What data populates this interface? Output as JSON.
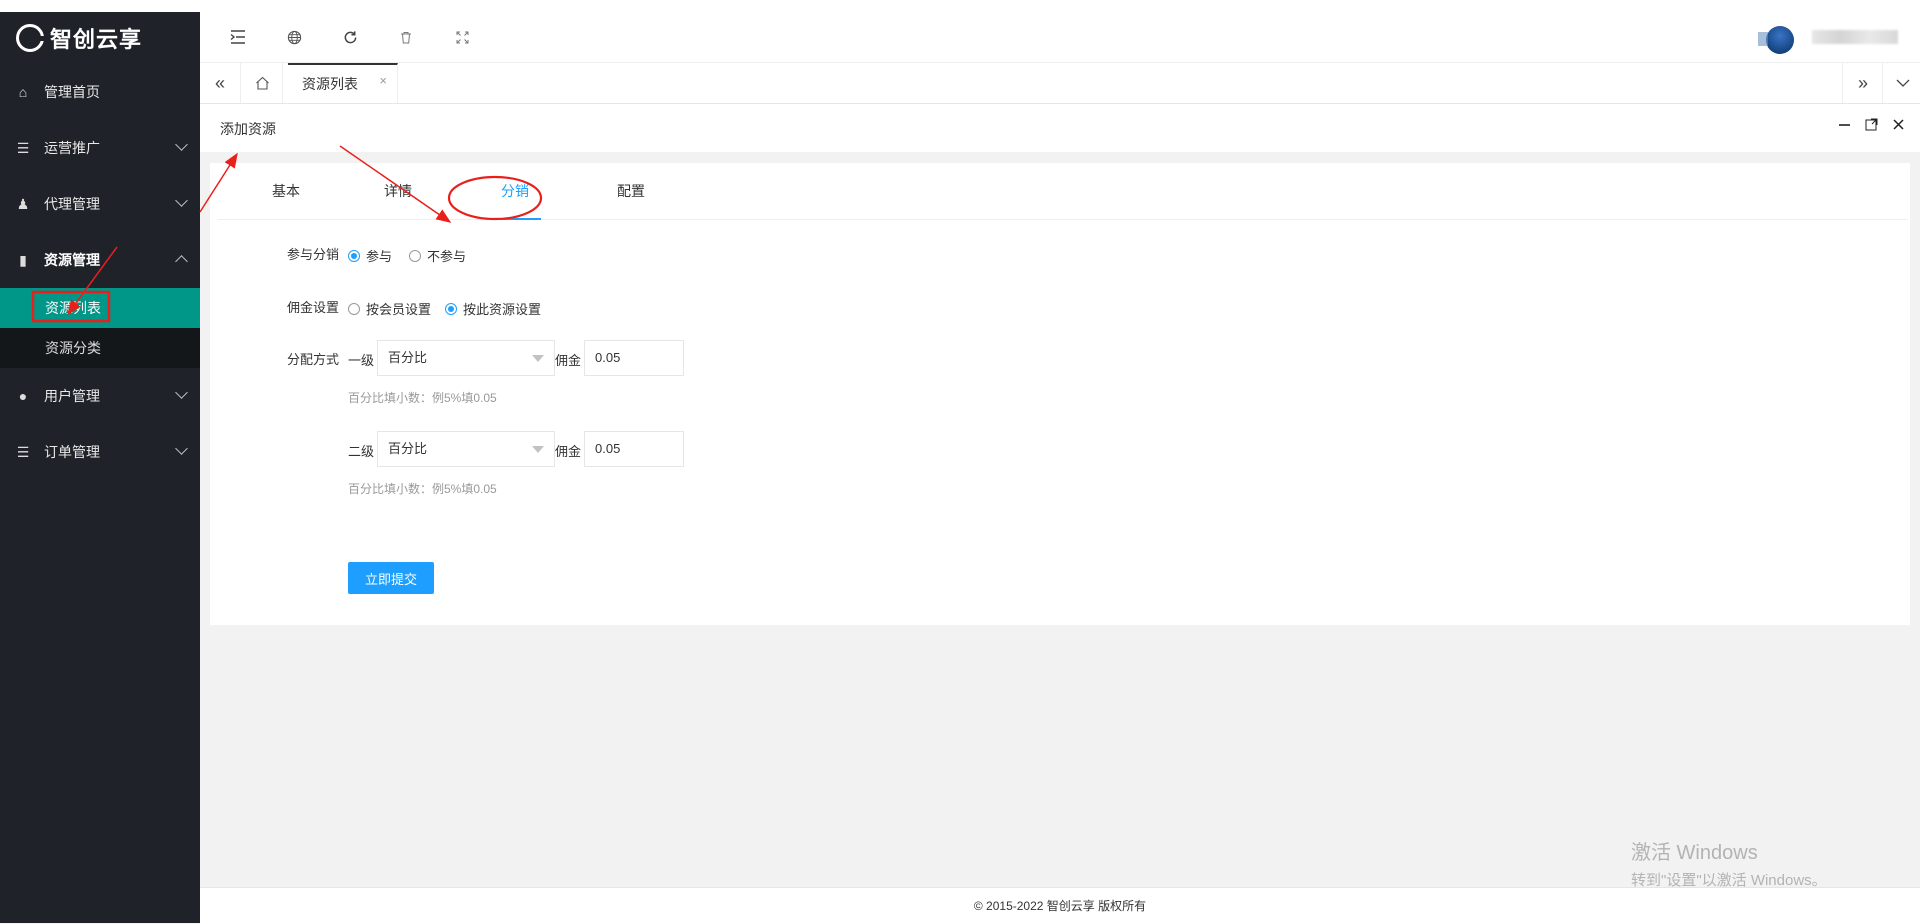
{
  "brand": {
    "name": "智创云享"
  },
  "sidebar": {
    "items": [
      {
        "label": "管理首页",
        "icon": "home-icon",
        "chevron": "none"
      },
      {
        "label": "运营推广",
        "icon": "list-icon",
        "chevron": "down"
      },
      {
        "label": "代理管理",
        "icon": "users-icon",
        "chevron": "down"
      },
      {
        "label": "资源管理",
        "icon": "book-icon",
        "chevron": "up",
        "expanded": true
      },
      {
        "label": "用户管理",
        "icon": "user-icon",
        "chevron": "down"
      },
      {
        "label": "订单管理",
        "icon": "list-icon",
        "chevron": "down"
      }
    ],
    "submenu": [
      {
        "label": "资源列表",
        "active": true
      },
      {
        "label": "资源分类",
        "active": false
      }
    ]
  },
  "header": {
    "icons": [
      "collapse-menu-icon",
      "globe-icon",
      "refresh-icon",
      "trash-icon",
      "fullscreen-icon"
    ]
  },
  "tabsbar": {
    "active_tab": "资源列表",
    "close": "×"
  },
  "dialog": {
    "title": "添加资源"
  },
  "form": {
    "tabs": [
      "基本",
      "详情",
      "分销",
      "配置"
    ],
    "active_tab": "分销",
    "participate": {
      "label": "参与分销",
      "options": [
        "参与",
        "不参与"
      ],
      "selected": "参与"
    },
    "commission_setting": {
      "label": "佣金设置",
      "options": [
        "按会员设置",
        "按此资源设置"
      ],
      "selected": "按此资源设置"
    },
    "distribution": {
      "label": "分配方式",
      "levels": [
        {
          "level": "一级",
          "type": "百分比",
          "commission_label": "佣金",
          "value": "0.05",
          "hint": "百分比填小数：例5%填0.05"
        },
        {
          "level": "二级",
          "type": "百分比",
          "commission_label": "佣金",
          "value": "0.05",
          "hint": "百分比填小数：例5%填0.05"
        }
      ]
    },
    "submit_label": "立即提交"
  },
  "footer": {
    "text": "© 2015-2022 智创云享 版权所有"
  },
  "watermark": {
    "line1": "激活 Windows",
    "line2": "转到\"设置\"以激活 Windows。"
  },
  "colors": {
    "sidebar": "#1f2329",
    "active": "#009688",
    "accent": "#1e9fff",
    "annotation": "#e8201c"
  }
}
